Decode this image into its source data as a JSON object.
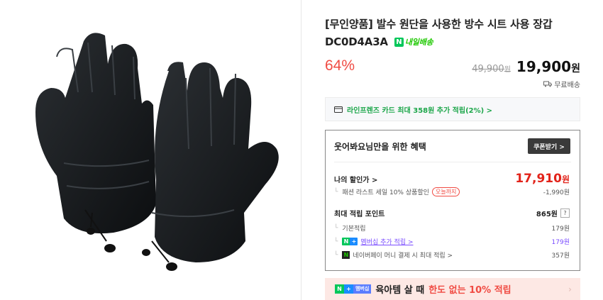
{
  "product": {
    "title": "[무인양품] 발수 원단을 사용한 방수 시트 사용 장갑 DC0D4A3A",
    "delivery_badge": "내일배송",
    "delivery_badge_icon": "n-logo-icon",
    "discount_rate": "64%",
    "original_price": "49,900",
    "original_price_unit": "원",
    "sale_price": "19,900",
    "sale_price_unit": "원",
    "shipping": "무료배송",
    "image_alt": "black padded winter gloves"
  },
  "card_benefit": {
    "text": "라인프렌즈 카드 최대 358원 추가 적립(2%) >"
  },
  "benefits": {
    "heading": "웃어봐요님만을 위한 혜택",
    "coupon_button": "쿠폰받기 >",
    "my_discount_label": "나의 할인가 >",
    "my_discount_price": "17,910",
    "my_discount_unit": "원",
    "sale_event_label": "패션 라스트 세일 10% 상품할인",
    "today_badge": "오늘까지",
    "sale_event_value": "-1,990원",
    "max_points_label": "최대 적립 포인트",
    "max_points_value": "865원",
    "question_mark": "?",
    "base_points_label": "기본적립",
    "base_points_value": "179원",
    "membership_label": "멤버십 추가 적립 >",
    "membership_value": "179원",
    "npay_label": "네이버페이 머니 결제 시 최대 적립 >",
    "npay_value": "357원"
  },
  "promo": {
    "tag_n": "N",
    "tag_plus": "+",
    "tag_membership": "멤버십",
    "text_before": "육아템 살 때",
    "text_highlight": "한도 없는 10% 적립"
  },
  "colors": {
    "discount_red": "#f04b43",
    "naver_green": "#03c75a",
    "membership_purple": "#7a4cff"
  }
}
